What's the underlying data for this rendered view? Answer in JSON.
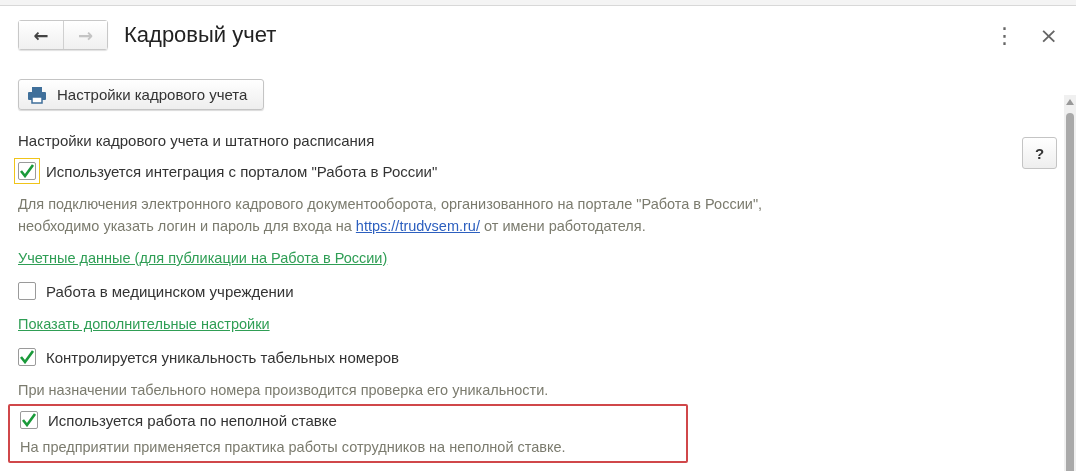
{
  "window": {
    "title": "Кадровый учет",
    "nav": [
      {
        "label": "←",
        "disabled": false
      },
      {
        "label": "→",
        "disabled": true
      }
    ],
    "menu_icon": "⋮",
    "close_icon": "×"
  },
  "toolbar": {
    "button": "Настройки кадрового учета"
  },
  "help_button": "?",
  "items": [
    {
      "kind": "heading",
      "text": "Настройки кадрового учета и штатного расписания"
    },
    {
      "kind": "checkbox",
      "text": "Используется интеграция с порталом \"Работа в России\"",
      "checked": true,
      "focused": true
    },
    {
      "kind": "note",
      "lines": [
        {
          "text": "Для подключения электронного кадрового документооборота, организованного на портале \"Работа в России\","
        },
        {
          "text": "необходимо указать логин и пароль для входа на ",
          "link": "https://trudvsem.ru/",
          "after": " от имени работодателя."
        }
      ]
    },
    {
      "kind": "link",
      "text": "Учетные данные (для публикации на Работа в России)"
    },
    {
      "kind": "checkbox",
      "text": "Работа в медицинском учреждении",
      "checked": false,
      "focused": false
    },
    {
      "kind": "link",
      "text": "Показать дополнительные настройки"
    },
    {
      "kind": "checkbox",
      "text": "Контролируется уникальность табельных номеров",
      "checked": true,
      "focused": false
    },
    {
      "kind": "note",
      "lines": [
        {
          "text": "При назначении табельного номера производится проверка его уникальности."
        }
      ]
    }
  ],
  "highlighted_items": [
    {
      "kind": "checkbox",
      "text": "Используется работа по неполной ставке",
      "checked": true,
      "focused": false
    },
    {
      "kind": "note",
      "lines": [
        {
          "text": "На предприятии применяется практика работы сотрудников на неполной ставке."
        }
      ]
    }
  ]
}
